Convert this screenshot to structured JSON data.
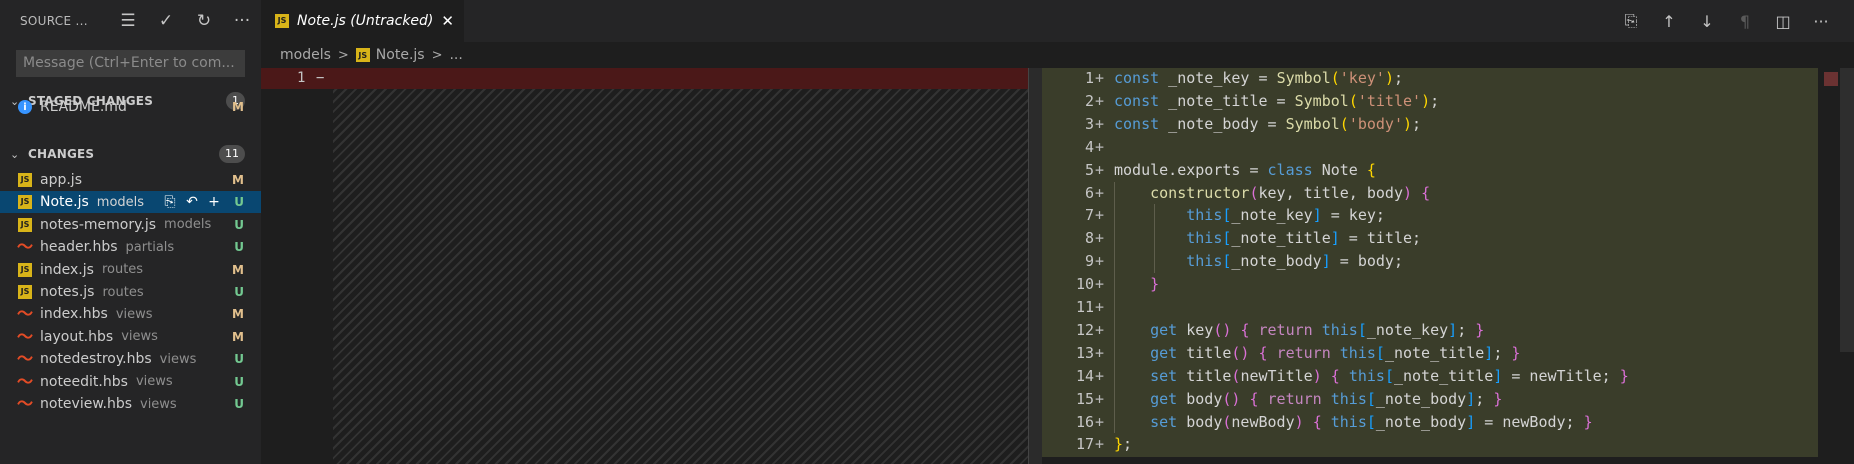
{
  "sidebar": {
    "title": "SOURCE ...",
    "actions": [
      {
        "name": "view-as-tree-icon",
        "glyph": "☰"
      },
      {
        "name": "commit-check-icon",
        "glyph": "✓"
      },
      {
        "name": "refresh-icon",
        "glyph": "↻"
      },
      {
        "name": "more-actions-icon",
        "glyph": "···"
      }
    ],
    "message_placeholder": "Message (Ctrl+Enter to com...",
    "staged": {
      "label": "STAGED CHANGES",
      "count": "1",
      "files": [
        {
          "name": "README.md",
          "dir": "",
          "status": "M",
          "icon": "info-icon"
        }
      ]
    },
    "changes": {
      "label": "CHANGES",
      "count": "11",
      "files": [
        {
          "name": "app.js",
          "dir": "",
          "status": "M",
          "icon": "js"
        },
        {
          "name": "Note.js",
          "dir": "models",
          "status": "U",
          "icon": "js",
          "selected": true
        },
        {
          "name": "notes-memory.js",
          "dir": "models",
          "status": "U",
          "icon": "js"
        },
        {
          "name": "header.hbs",
          "dir": "partials",
          "status": "U",
          "icon": "hbs"
        },
        {
          "name": "index.js",
          "dir": "routes",
          "status": "M",
          "icon": "js"
        },
        {
          "name": "notes.js",
          "dir": "routes",
          "status": "U",
          "icon": "js"
        },
        {
          "name": "index.hbs",
          "dir": "views",
          "status": "M",
          "icon": "hbs"
        },
        {
          "name": "layout.hbs",
          "dir": "views",
          "status": "M",
          "icon": "hbs"
        },
        {
          "name": "notedestroy.hbs",
          "dir": "views",
          "status": "U",
          "icon": "hbs"
        },
        {
          "name": "noteedit.hbs",
          "dir": "views",
          "status": "U",
          "icon": "hbs"
        },
        {
          "name": "noteview.hbs",
          "dir": "views",
          "status": "U",
          "icon": "hbs"
        }
      ]
    },
    "row_actions": [
      "open-file-icon",
      "discard-changes-icon",
      "stage-changes-icon"
    ]
  },
  "tab": {
    "label": "Note.js (Untracked)",
    "icon_text": "JS",
    "close": "✕"
  },
  "editor_actions": [
    {
      "name": "open-file-icon",
      "glyph": "⎘"
    },
    {
      "name": "previous-change-icon",
      "glyph": "↑"
    },
    {
      "name": "next-change-icon",
      "glyph": "↓"
    },
    {
      "name": "pilcrow-icon",
      "glyph": "¶"
    },
    {
      "name": "split-editor-icon",
      "glyph": "◫"
    },
    {
      "name": "more-actions-icon",
      "glyph": "···"
    }
  ],
  "breadcrumb": {
    "folder": "models",
    "sep": ">",
    "file": "Note.js",
    "trail": "..."
  },
  "left_pane": {
    "line_number": "1",
    "marker": "−"
  },
  "colors": {
    "accent": "#094771",
    "deleted": "#4b1818",
    "inserted": "#3a3d2a",
    "modified": "#e2c08d",
    "untracked": "#73c991"
  },
  "code_lines": [
    {
      "n": "1",
      "tokens": [
        [
          "kw",
          "const"
        ],
        [
          "var",
          " _note_key = "
        ],
        [
          "fn",
          "Symbol"
        ],
        [
          "br1",
          "("
        ],
        [
          "str",
          "'key'"
        ],
        [
          "br1",
          ")"
        ],
        [
          "var",
          ";"
        ]
      ]
    },
    {
      "n": "2",
      "tokens": [
        [
          "kw",
          "const"
        ],
        [
          "var",
          " _note_title = "
        ],
        [
          "fn",
          "Symbol"
        ],
        [
          "br1",
          "("
        ],
        [
          "str",
          "'title'"
        ],
        [
          "br1",
          ")"
        ],
        [
          "var",
          ";"
        ]
      ]
    },
    {
      "n": "3",
      "tokens": [
        [
          "kw",
          "const"
        ],
        [
          "var",
          " _note_body = "
        ],
        [
          "fn",
          "Symbol"
        ],
        [
          "br1",
          "("
        ],
        [
          "str",
          "'body'"
        ],
        [
          "br1",
          ")"
        ],
        [
          "var",
          ";"
        ]
      ]
    },
    {
      "n": "4",
      "tokens": []
    },
    {
      "n": "5",
      "tokens": [
        [
          "var",
          "module.exports = "
        ],
        [
          "kw",
          "class"
        ],
        [
          "var",
          " Note "
        ],
        [
          "br1",
          "{"
        ]
      ]
    },
    {
      "n": "6",
      "tokens": [
        [
          "var",
          "    "
        ],
        [
          "fn",
          "constructor"
        ],
        [
          "br2",
          "("
        ],
        [
          "var",
          "key, title, body"
        ],
        [
          "br2",
          ")"
        ],
        [
          "var",
          " "
        ],
        [
          "br2",
          "{"
        ]
      ]
    },
    {
      "n": "7",
      "tokens": [
        [
          "var",
          "        "
        ],
        [
          "kw",
          "this"
        ],
        [
          "br3",
          "["
        ],
        [
          "var",
          "_note_key"
        ],
        [
          "br3",
          "]"
        ],
        [
          "var",
          " = key;"
        ]
      ]
    },
    {
      "n": "8",
      "tokens": [
        [
          "var",
          "        "
        ],
        [
          "kw",
          "this"
        ],
        [
          "br3",
          "["
        ],
        [
          "var",
          "_note_title"
        ],
        [
          "br3",
          "]"
        ],
        [
          "var",
          " = title;"
        ]
      ]
    },
    {
      "n": "9",
      "tokens": [
        [
          "var",
          "        "
        ],
        [
          "kw",
          "this"
        ],
        [
          "br3",
          "["
        ],
        [
          "var",
          "_note_body"
        ],
        [
          "br3",
          "]"
        ],
        [
          "var",
          " = body;"
        ]
      ]
    },
    {
      "n": "10",
      "tokens": [
        [
          "var",
          "    "
        ],
        [
          "br2",
          "}"
        ]
      ]
    },
    {
      "n": "11",
      "tokens": []
    },
    {
      "n": "12",
      "tokens": [
        [
          "var",
          "    "
        ],
        [
          "kw",
          "get"
        ],
        [
          "var",
          " key"
        ],
        [
          "br2",
          "()"
        ],
        [
          "var",
          " "
        ],
        [
          "br2",
          "{"
        ],
        [
          "var",
          " "
        ],
        [
          "ctrl",
          "return"
        ],
        [
          "var",
          " "
        ],
        [
          "kw",
          "this"
        ],
        [
          "br3",
          "["
        ],
        [
          "var",
          "_note_key"
        ],
        [
          "br3",
          "]"
        ],
        [
          "var",
          "; "
        ],
        [
          "br2",
          "}"
        ]
      ]
    },
    {
      "n": "13",
      "tokens": [
        [
          "var",
          "    "
        ],
        [
          "kw",
          "get"
        ],
        [
          "var",
          " title"
        ],
        [
          "br2",
          "()"
        ],
        [
          "var",
          " "
        ],
        [
          "br2",
          "{"
        ],
        [
          "var",
          " "
        ],
        [
          "ctrl",
          "return"
        ],
        [
          "var",
          " "
        ],
        [
          "kw",
          "this"
        ],
        [
          "br3",
          "["
        ],
        [
          "var",
          "_note_title"
        ],
        [
          "br3",
          "]"
        ],
        [
          "var",
          "; "
        ],
        [
          "br2",
          "}"
        ]
      ]
    },
    {
      "n": "14",
      "tokens": [
        [
          "var",
          "    "
        ],
        [
          "kw",
          "set"
        ],
        [
          "var",
          " title"
        ],
        [
          "br2",
          "("
        ],
        [
          "var",
          "newTitle"
        ],
        [
          "br2",
          ")"
        ],
        [
          "var",
          " "
        ],
        [
          "br2",
          "{"
        ],
        [
          "var",
          " "
        ],
        [
          "kw",
          "this"
        ],
        [
          "br3",
          "["
        ],
        [
          "var",
          "_note_title"
        ],
        [
          "br3",
          "]"
        ],
        [
          "var",
          " = newTitle; "
        ],
        [
          "br2",
          "}"
        ]
      ]
    },
    {
      "n": "15",
      "tokens": [
        [
          "var",
          "    "
        ],
        [
          "kw",
          "get"
        ],
        [
          "var",
          " body"
        ],
        [
          "br2",
          "()"
        ],
        [
          "var",
          " "
        ],
        [
          "br2",
          "{"
        ],
        [
          "var",
          " "
        ],
        [
          "ctrl",
          "return"
        ],
        [
          "var",
          " "
        ],
        [
          "kw",
          "this"
        ],
        [
          "br3",
          "["
        ],
        [
          "var",
          "_note_body"
        ],
        [
          "br3",
          "]"
        ],
        [
          "var",
          "; "
        ],
        [
          "br2",
          "}"
        ]
      ]
    },
    {
      "n": "16",
      "tokens": [
        [
          "var",
          "    "
        ],
        [
          "kw",
          "set"
        ],
        [
          "var",
          " body"
        ],
        [
          "br2",
          "("
        ],
        [
          "var",
          "newBody"
        ],
        [
          "br2",
          ")"
        ],
        [
          "var",
          " "
        ],
        [
          "br2",
          "{"
        ],
        [
          "var",
          " "
        ],
        [
          "kw",
          "this"
        ],
        [
          "br3",
          "["
        ],
        [
          "var",
          "_note_body"
        ],
        [
          "br3",
          "]"
        ],
        [
          "var",
          " = newBody; "
        ],
        [
          "br2",
          "}"
        ]
      ]
    },
    {
      "n": "17",
      "tokens": [
        [
          "br1",
          "}"
        ],
        [
          "var",
          ";"
        ]
      ]
    }
  ],
  "plus_marker": "+"
}
